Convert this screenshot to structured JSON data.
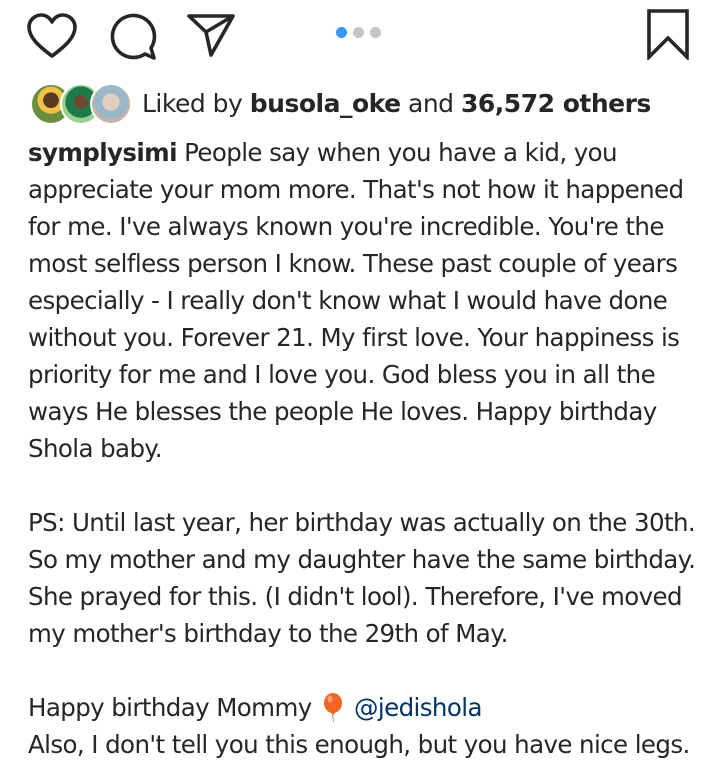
{
  "actions": {
    "like_icon": "heart-icon",
    "comment_icon": "comment-icon",
    "share_icon": "paper-plane-icon",
    "save_icon": "bookmark-icon",
    "carousel_count": 3,
    "carousel_active_index": 0
  },
  "likes": {
    "prefix": "Liked by",
    "user": "busola_oke",
    "conjunction": "and",
    "others": "36,572 others"
  },
  "caption": {
    "username": "symplysimi",
    "paragraph1": "People say when you have a kid, you appreciate your mom more. That's not how it happened for me. I've always known you're incredible. You're the most selfless person I know. These past couple of years especially - I really don't know what I would have done without you. Forever 21. My first love. Your happiness is priority for me and I love you. God bless you in all the ways He blesses the people He loves. Happy birthday Shola baby.",
    "paragraph2": "PS: Until last year, her birthday was actually on the 30th. So my mother and my daughter have the same birthday. She prayed for this. (I didn't lool). Therefore, I've moved my mother's birthday to the 29th of May.",
    "paragraph3_text": "Happy birthday Mommy",
    "paragraph3_emoji": "balloon-icon",
    "paragraph3_mention": "@jedishola",
    "paragraph4": "Also, I don't tell you this enough, but you have nice legs."
  },
  "colors": {
    "text": "#262626",
    "mention": "#003569",
    "active_dot": "#3897f0",
    "balloon": "#f26522"
  }
}
